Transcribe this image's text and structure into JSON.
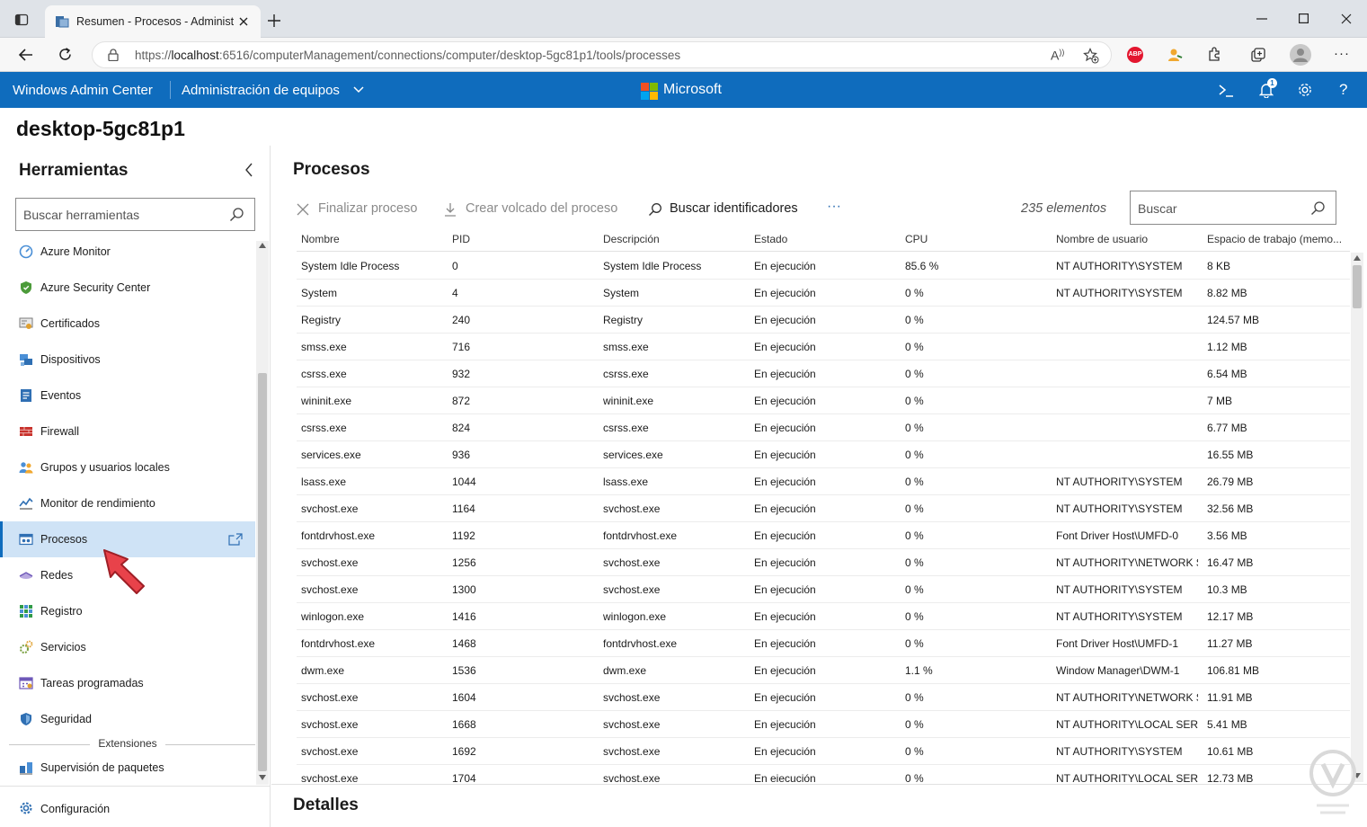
{
  "browser": {
    "tab_title": "Resumen - Procesos - Administrad",
    "url_prefix": "https://",
    "url_host": "localhost",
    "url_rest": ":6516/computerManagement/connections/computer/desktop-5gc81p1/tools/processes",
    "adblock_label": "ABP",
    "notification_count": "1"
  },
  "header": {
    "app_name": "Windows Admin Center",
    "context": "Administración de equipos",
    "brand": "Microsoft",
    "accent": "#0f6cbd"
  },
  "computer_name": "desktop-5gc81p1",
  "tools": {
    "title": "Herramientas",
    "search_placeholder": "Buscar herramientas",
    "items": [
      {
        "label": "Azure Monitor",
        "icon": "azure-monitor-icon"
      },
      {
        "label": "Azure Security Center",
        "icon": "azure-security-icon"
      },
      {
        "label": "Certificados",
        "icon": "certificate-icon"
      },
      {
        "label": "Dispositivos",
        "icon": "devices-icon"
      },
      {
        "label": "Eventos",
        "icon": "events-icon"
      },
      {
        "label": "Firewall",
        "icon": "firewall-icon"
      },
      {
        "label": "Grupos y usuarios locales",
        "icon": "users-icon"
      },
      {
        "label": "Monitor de rendimiento",
        "icon": "performance-icon"
      },
      {
        "label": "Procesos",
        "icon": "processes-icon",
        "selected": true
      },
      {
        "label": "Redes",
        "icon": "network-icon"
      },
      {
        "label": "Registro",
        "icon": "registry-icon"
      },
      {
        "label": "Servicios",
        "icon": "services-icon"
      },
      {
        "label": "Tareas programadas",
        "icon": "scheduled-tasks-icon"
      },
      {
        "label": "Seguridad",
        "icon": "security-icon"
      }
    ],
    "extensions_label": "Extensiones",
    "extension_items": [
      {
        "label": "Supervisión de paquetes",
        "icon": "package-icon"
      }
    ],
    "settings_label": "Configuración"
  },
  "main": {
    "title": "Procesos",
    "toolbar": {
      "end_process": "Finalizar proceso",
      "create_dump": "Crear volcado del proceso",
      "find_handles": "Buscar identificadores",
      "more": "···"
    },
    "item_count": "235 elementos",
    "search_placeholder": "Buscar",
    "columns": [
      "Nombre",
      "PID",
      "Descripción",
      "Estado",
      "CPU",
      "Nombre de usuario",
      "Espacio de trabajo (memo..."
    ],
    "rows": [
      [
        "System Idle Process",
        "0",
        "System Idle Process",
        "En ejecución",
        "85.6 %",
        "NT AUTHORITY\\SYSTEM",
        "8 KB"
      ],
      [
        "System",
        "4",
        "System",
        "En ejecución",
        "0 %",
        "NT AUTHORITY\\SYSTEM",
        "8.82 MB"
      ],
      [
        "Registry",
        "240",
        "Registry",
        "En ejecución",
        "0 %",
        "",
        "124.57 MB"
      ],
      [
        "smss.exe",
        "716",
        "smss.exe",
        "En ejecución",
        "0 %",
        "",
        "1.12 MB"
      ],
      [
        "csrss.exe",
        "932",
        "csrss.exe",
        "En ejecución",
        "0 %",
        "",
        "6.54 MB"
      ],
      [
        "wininit.exe",
        "872",
        "wininit.exe",
        "En ejecución",
        "0 %",
        "",
        "7 MB"
      ],
      [
        "csrss.exe",
        "824",
        "csrss.exe",
        "En ejecución",
        "0 %",
        "",
        "6.77 MB"
      ],
      [
        "services.exe",
        "936",
        "services.exe",
        "En ejecución",
        "0 %",
        "",
        "16.55 MB"
      ],
      [
        "lsass.exe",
        "1044",
        "lsass.exe",
        "En ejecución",
        "0 %",
        "NT AUTHORITY\\SYSTEM",
        "26.79 MB"
      ],
      [
        "svchost.exe",
        "1164",
        "svchost.exe",
        "En ejecución",
        "0 %",
        "NT AUTHORITY\\SYSTEM",
        "32.56 MB"
      ],
      [
        "fontdrvhost.exe",
        "1192",
        "fontdrvhost.exe",
        "En ejecución",
        "0 %",
        "Font Driver Host\\UMFD-0",
        "3.56 MB"
      ],
      [
        "svchost.exe",
        "1256",
        "svchost.exe",
        "En ejecución",
        "0 %",
        "NT AUTHORITY\\NETWORK SERVICE",
        "16.47 MB"
      ],
      [
        "svchost.exe",
        "1300",
        "svchost.exe",
        "En ejecución",
        "0 %",
        "NT AUTHORITY\\SYSTEM",
        "10.3 MB"
      ],
      [
        "winlogon.exe",
        "1416",
        "winlogon.exe",
        "En ejecución",
        "0 %",
        "NT AUTHORITY\\SYSTEM",
        "12.17 MB"
      ],
      [
        "fontdrvhost.exe",
        "1468",
        "fontdrvhost.exe",
        "En ejecución",
        "0 %",
        "Font Driver Host\\UMFD-1",
        "11.27 MB"
      ],
      [
        "dwm.exe",
        "1536",
        "dwm.exe",
        "En ejecución",
        "1.1 %",
        "Window Manager\\DWM-1",
        "106.81 MB"
      ],
      [
        "svchost.exe",
        "1604",
        "svchost.exe",
        "En ejecución",
        "0 %",
        "NT AUTHORITY\\NETWORK SERVICE",
        "11.91 MB"
      ],
      [
        "svchost.exe",
        "1668",
        "svchost.exe",
        "En ejecución",
        "0 %",
        "NT AUTHORITY\\LOCAL SERVICE",
        "5.41 MB"
      ],
      [
        "svchost.exe",
        "1692",
        "svchost.exe",
        "En ejecución",
        "0 %",
        "NT AUTHORITY\\SYSTEM",
        "10.61 MB"
      ],
      [
        "svchost.exe",
        "1704",
        "svchost.exe",
        "En ejecución",
        "0 %",
        "NT AUTHORITY\\LOCAL SERVICE",
        "12.73 MB"
      ]
    ]
  },
  "details": {
    "title": "Detalles"
  }
}
